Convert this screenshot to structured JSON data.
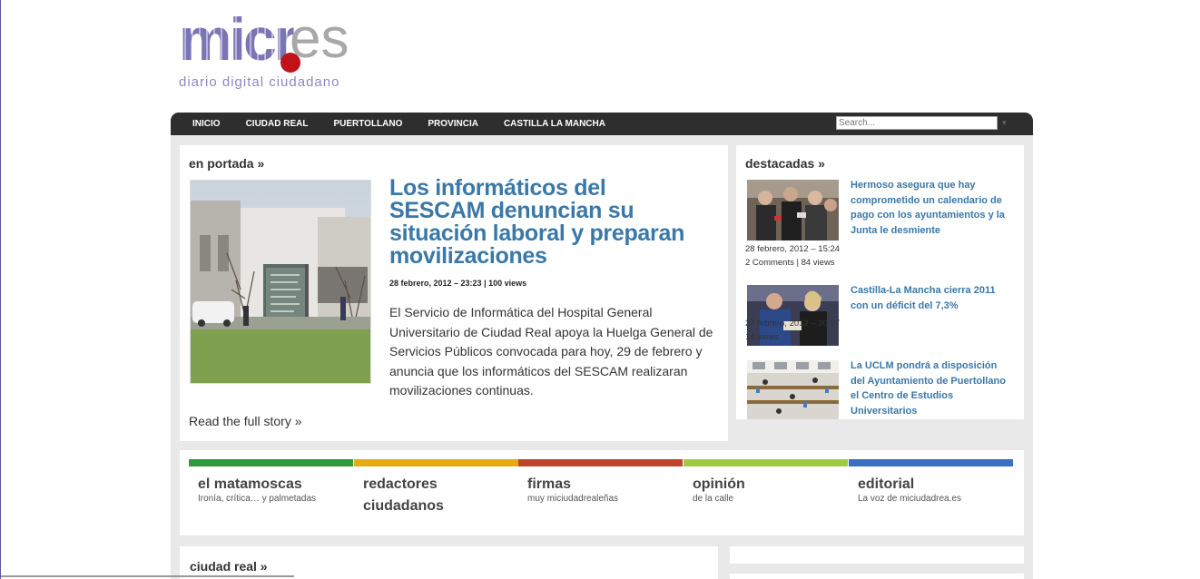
{
  "logo": {
    "main": "micr",
    "suffix": "es",
    "tagline": "diario digital ciudadano"
  },
  "nav": {
    "items": [
      "INICIO",
      "CIUDAD REAL",
      "PUERTOLLANO",
      "PROVINCIA",
      "CASTILLA LA MANCHA"
    ],
    "search_placeholder": "Search..."
  },
  "portada": {
    "section_title": "en portada »",
    "headline": "Los informáticos del SESCAM denuncian su situación laboral y preparan movilizaciones",
    "meta": "28 febrero, 2012 – 23:23 | 100 views",
    "excerpt": "El Servicio de Informática del Hospital General Universitario de Ciudad Real apoya la Huelga General de Servicios Públicos convocada para hoy, 29 de febrero y anuncia que los informáticos del SESCAM realizaran movilizaciones continuas.",
    "read_more": "Read the full story »"
  },
  "destacadas": {
    "section_title": "destacadas »",
    "items": [
      {
        "title": "Hermoso asegura que hay comprometido un calendario de pago con los ayuntamientos y la Junta le desmiente",
        "date": "28 febrero, 2012 – 15:24",
        "stats": "2 Comments | 84 views"
      },
      {
        "title": "Castilla-La Mancha cierra 2011 con un déficit del 7,3%",
        "date": "27 febrero, 2012 – 20:57",
        "stats": "14 views"
      },
      {
        "title": "La UCLM pondrá a disposición del Ayuntamiento de Puertollano el Centro de Estudios Universitarios",
        "date": "",
        "stats": ""
      }
    ]
  },
  "categories": [
    {
      "name": "el matamoscas",
      "sub": "Ironía, crítica… y palmetadas",
      "color": "#2e9a3a"
    },
    {
      "name": "redactores ciudadanos",
      "sub": "",
      "color": "#e6aa13"
    },
    {
      "name": "firmas",
      "sub": "muy miciudadrealeñas",
      "color": "#bf4429"
    },
    {
      "name": "opinión",
      "sub": "de la calle",
      "color": "#9fcb3f"
    },
    {
      "name": "editorial",
      "sub": "La voz de miciudadrea.es",
      "color": "#3a6fc4"
    }
  ],
  "ciudadreal": {
    "section_title": "ciudad real »"
  },
  "colors": {
    "accent": "#3a78a8",
    "nav_bg": "#2e2e2e",
    "page_bg": "#e9e9e9",
    "logo_dot": "#c1121b"
  }
}
